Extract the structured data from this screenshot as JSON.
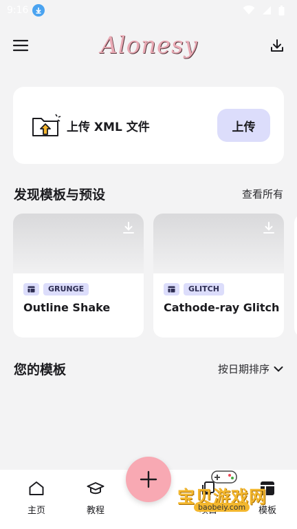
{
  "status": {
    "time": "9:16"
  },
  "appbar": {
    "logo": "Alonesy"
  },
  "upload": {
    "title": "上传 XML 文件",
    "button": "上传"
  },
  "discover": {
    "heading": "发现模板与预设",
    "see_all": "查看所有",
    "cards": [
      {
        "tag": "GRUNGE",
        "name": "Outline Shake"
      },
      {
        "tag": "GLITCH",
        "name": "Cathode-ray Glitch"
      }
    ]
  },
  "templates": {
    "heading": "您的模板",
    "sort": "按日期排序"
  },
  "nav": [
    {
      "label": "主页",
      "icon": "home-icon"
    },
    {
      "label": "教程",
      "icon": "graduation-cap-icon"
    },
    {
      "label": "项目",
      "icon": "copy-icon"
    },
    {
      "label": "模板",
      "icon": "template-icon"
    }
  ],
  "watermark": {
    "text": "宝贝游戏网",
    "url": "baobeiy.com"
  },
  "colors": {
    "accent": "#dcddfb",
    "fab": "#f8a9b3",
    "background": "#f3f3f4"
  }
}
